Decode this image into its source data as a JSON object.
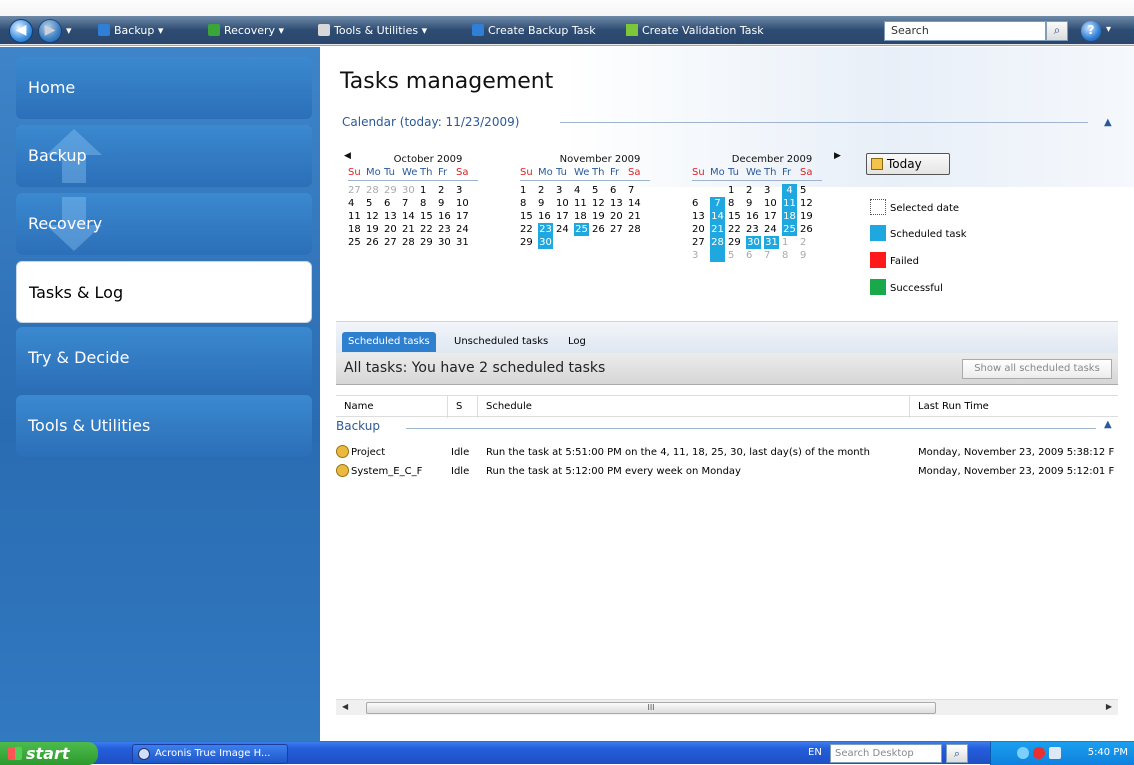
{
  "toolbar": {
    "back_label": "Back",
    "forward_label": "Forward",
    "items": [
      {
        "label": "Backup ▾"
      },
      {
        "label": "Recovery ▾"
      },
      {
        "label": "Tools & Utilities ▾"
      },
      {
        "label": "Create Backup Task"
      },
      {
        "label": "Create Validation Task"
      }
    ],
    "search_placeholder": "Search",
    "help_label": "?"
  },
  "sidebar": {
    "items": [
      {
        "label": "Home"
      },
      {
        "label": "Backup"
      },
      {
        "label": "Recovery"
      },
      {
        "label": "Tasks & Log"
      },
      {
        "label": "Try & Decide"
      },
      {
        "label": "Tools & Utilities"
      }
    ],
    "active_index": 3
  },
  "main": {
    "title": "Tasks management",
    "calendar_header": "Calendar (today: 11/23/2009)",
    "today_button": "Today",
    "weekday_labels": [
      "Su",
      "Mo",
      "Tu",
      "We",
      "Th",
      "Fr",
      "Sa"
    ],
    "months": [
      {
        "title": "October 2009",
        "weeks": [
          [
            "27",
            "28",
            "29",
            "30",
            "1",
            "2",
            "3"
          ],
          [
            "4",
            "5",
            "6",
            "7",
            "8",
            "9",
            "10"
          ],
          [
            "11",
            "12",
            "13",
            "14",
            "15",
            "16",
            "17"
          ],
          [
            "18",
            "19",
            "20",
            "21",
            "22",
            "23",
            "24"
          ],
          [
            "25",
            "26",
            "27",
            "28",
            "29",
            "30",
            "31"
          ]
        ],
        "other": [
          [
            true,
            true,
            true,
            true,
            false,
            false,
            false
          ]
        ],
        "scheduled": []
      },
      {
        "title": "November 2009",
        "weeks": [
          [
            "1",
            "2",
            "3",
            "4",
            "5",
            "6",
            "7"
          ],
          [
            "8",
            "9",
            "10",
            "11",
            "12",
            "13",
            "14"
          ],
          [
            "15",
            "16",
            "17",
            "18",
            "19",
            "20",
            "21"
          ],
          [
            "22",
            "23",
            "24",
            "25",
            "26",
            "27",
            "28"
          ],
          [
            "29",
            "30",
            "",
            "",
            "",
            "",
            ""
          ]
        ],
        "scheduled": [
          "23",
          "25",
          "30"
        ]
      },
      {
        "title": "December 2009",
        "weeks": [
          [
            "",
            "",
            "1",
            "2",
            "3",
            "4",
            "5"
          ],
          [
            "6",
            "7",
            "8",
            "9",
            "10",
            "11",
            "12"
          ],
          [
            "13",
            "14",
            "15",
            "16",
            "17",
            "18",
            "19"
          ],
          [
            "20",
            "21",
            "22",
            "23",
            "24",
            "25",
            "26"
          ],
          [
            "27",
            "28",
            "29",
            "30",
            "31",
            "1",
            "2"
          ],
          [
            "3",
            "4",
            "5",
            "6",
            "7",
            "8",
            "9"
          ]
        ],
        "scheduled": [
          "4",
          "7",
          "11",
          "14",
          "18",
          "21",
          "25",
          "28",
          "30",
          "31"
        ]
      }
    ],
    "legend": [
      {
        "label": "Selected date",
        "color": "#ffffff"
      },
      {
        "label": "Scheduled task",
        "color": "#1fa8e0"
      },
      {
        "label": "Failed",
        "color": "#ff1a1a"
      },
      {
        "label": "Successful",
        "color": "#1aa84a"
      }
    ],
    "tabs": [
      {
        "label": "Scheduled tasks"
      },
      {
        "label": "Unscheduled tasks"
      },
      {
        "label": "Log"
      }
    ],
    "all_tasks_text": "All tasks: You have 2 scheduled tasks",
    "show_all_button": "Show all scheduled tasks",
    "columns": [
      "Name",
      "S",
      "Schedule",
      "Last Run Time"
    ],
    "group": "Backup",
    "rows": [
      {
        "name": "Project",
        "status": "Idle",
        "schedule": "Run the task at 5:51:00 PM on the 4, 11, 18, 25, 30, last day(s) of the month",
        "last_run": "Monday, November 23, 2009 5:38:12 F"
      },
      {
        "name": "System_E_C_F",
        "status": "Idle",
        "schedule": "Run the task at 5:12:00 PM every week on Monday",
        "last_run": "Monday, November 23, 2009 5:12:01 F"
      }
    ],
    "scroll_thumb_label": "III"
  },
  "taskbar": {
    "start_label": "start",
    "app_label": "Acronis True Image H...",
    "language": "EN",
    "search_placeholder": "Search Desktop",
    "clock": "5:40 PM"
  }
}
